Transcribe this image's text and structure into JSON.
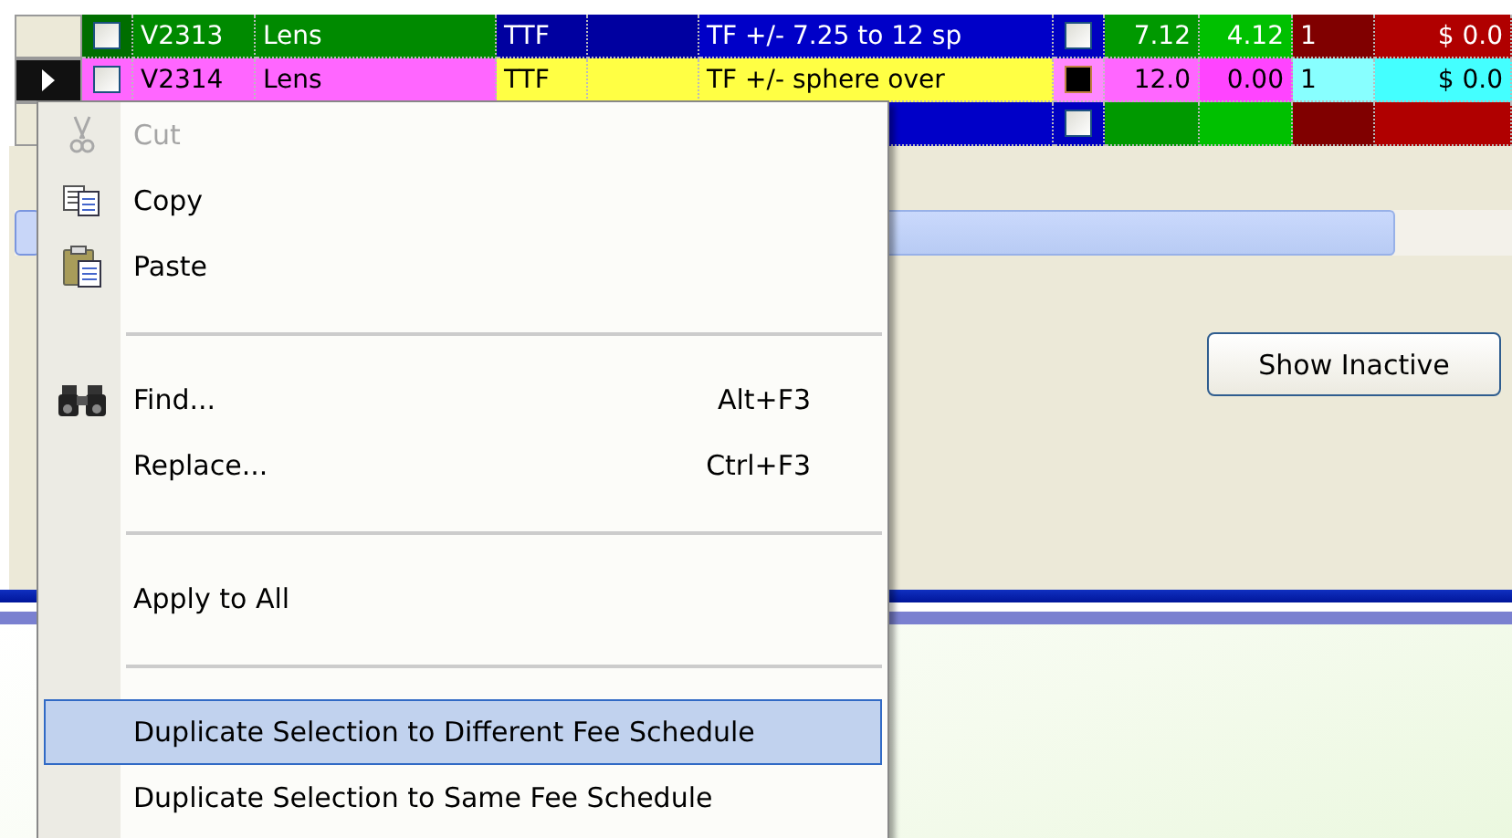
{
  "grid": {
    "rows": [
      {
        "current": false,
        "cells": [
          {
            "kind": "check",
            "checked": false,
            "color": "#006e00"
          },
          {
            "kind": "text",
            "text": "V2313",
            "color": "#008a00"
          },
          {
            "kind": "text",
            "text": "Lens",
            "color": "#008a00"
          },
          {
            "kind": "text",
            "text": "TTF",
            "color": "#0000a0"
          },
          {
            "kind": "text",
            "color": "#0000a0"
          },
          {
            "kind": "text",
            "text": "TF +/- 7.25 to 12 sp",
            "color": "#0000c8"
          },
          {
            "kind": "check",
            "checked": false,
            "color": "#0000c0"
          },
          {
            "kind": "text",
            "text": "7.12",
            "color": "#009900"
          },
          {
            "kind": "text",
            "text": "4.12",
            "color": "#00c000"
          },
          {
            "kind": "text",
            "text": "1",
            "color": "#800000"
          },
          {
            "kind": "text",
            "text": "$ 0.0",
            "color": "#b00000"
          }
        ]
      },
      {
        "current": true,
        "cells": [
          {
            "kind": "check",
            "checked": false,
            "color": "#ff66ff"
          },
          {
            "kind": "text",
            "text": "V2314",
            "color": "#ff66ff"
          },
          {
            "kind": "text",
            "text": "Lens",
            "color": "#ff66ff"
          },
          {
            "kind": "text",
            "text": "TTF",
            "color": "#ffff44"
          },
          {
            "kind": "text",
            "color": "#ffff44"
          },
          {
            "kind": "text",
            "text": "TF +/- sphere over",
            "color": "#ffff44"
          },
          {
            "kind": "check",
            "checked": true,
            "color": "#ff88ff"
          },
          {
            "kind": "text",
            "text": "12.0",
            "color": "#ff66ff"
          },
          {
            "kind": "text",
            "text": "0.00",
            "color": "#ff44ff"
          },
          {
            "kind": "text",
            "text": "1",
            "color": "#88ffff"
          },
          {
            "kind": "text",
            "text": "$ 0.0",
            "color": "#44ffff"
          }
        ]
      },
      {
        "current": false,
        "cells": [
          null,
          null,
          null,
          null,
          null,
          {
            "kind": "text",
            "color": "#0000c8"
          },
          {
            "kind": "check",
            "checked": false,
            "color": "#0000c0"
          },
          {
            "kind": "text",
            "color": "#009900"
          },
          {
            "kind": "text",
            "color": "#00c000"
          },
          {
            "kind": "text",
            "color": "#800000"
          },
          {
            "kind": "text",
            "color": "#b00000"
          }
        ]
      }
    ]
  },
  "show_inactive_button": "Show Inactive",
  "context_menu": [
    {
      "kind": "item",
      "label": "Cut",
      "disabled": true,
      "selected": false
    },
    {
      "kind": "item",
      "label": "Copy",
      "disabled": false,
      "selected": false
    },
    {
      "kind": "item",
      "label": "Paste",
      "disabled": false,
      "selected": false
    },
    {
      "kind": "separator"
    },
    {
      "kind": "item",
      "label": "Find...",
      "shortcut": "Alt+F3",
      "disabled": false,
      "selected": false
    },
    {
      "kind": "item",
      "label": "Replace...",
      "shortcut": "Ctrl+F3",
      "disabled": false,
      "selected": false
    },
    {
      "kind": "separator"
    },
    {
      "kind": "item",
      "label": "Apply to All",
      "disabled": false,
      "selected": false
    },
    {
      "kind": "separator"
    },
    {
      "kind": "item",
      "label": "Duplicate Selection to Different Fee Schedule",
      "disabled": false,
      "selected": true
    },
    {
      "kind": "item",
      "label": "Duplicate Selection to Same Fee Schedule",
      "disabled": false,
      "selected": false
    }
  ]
}
